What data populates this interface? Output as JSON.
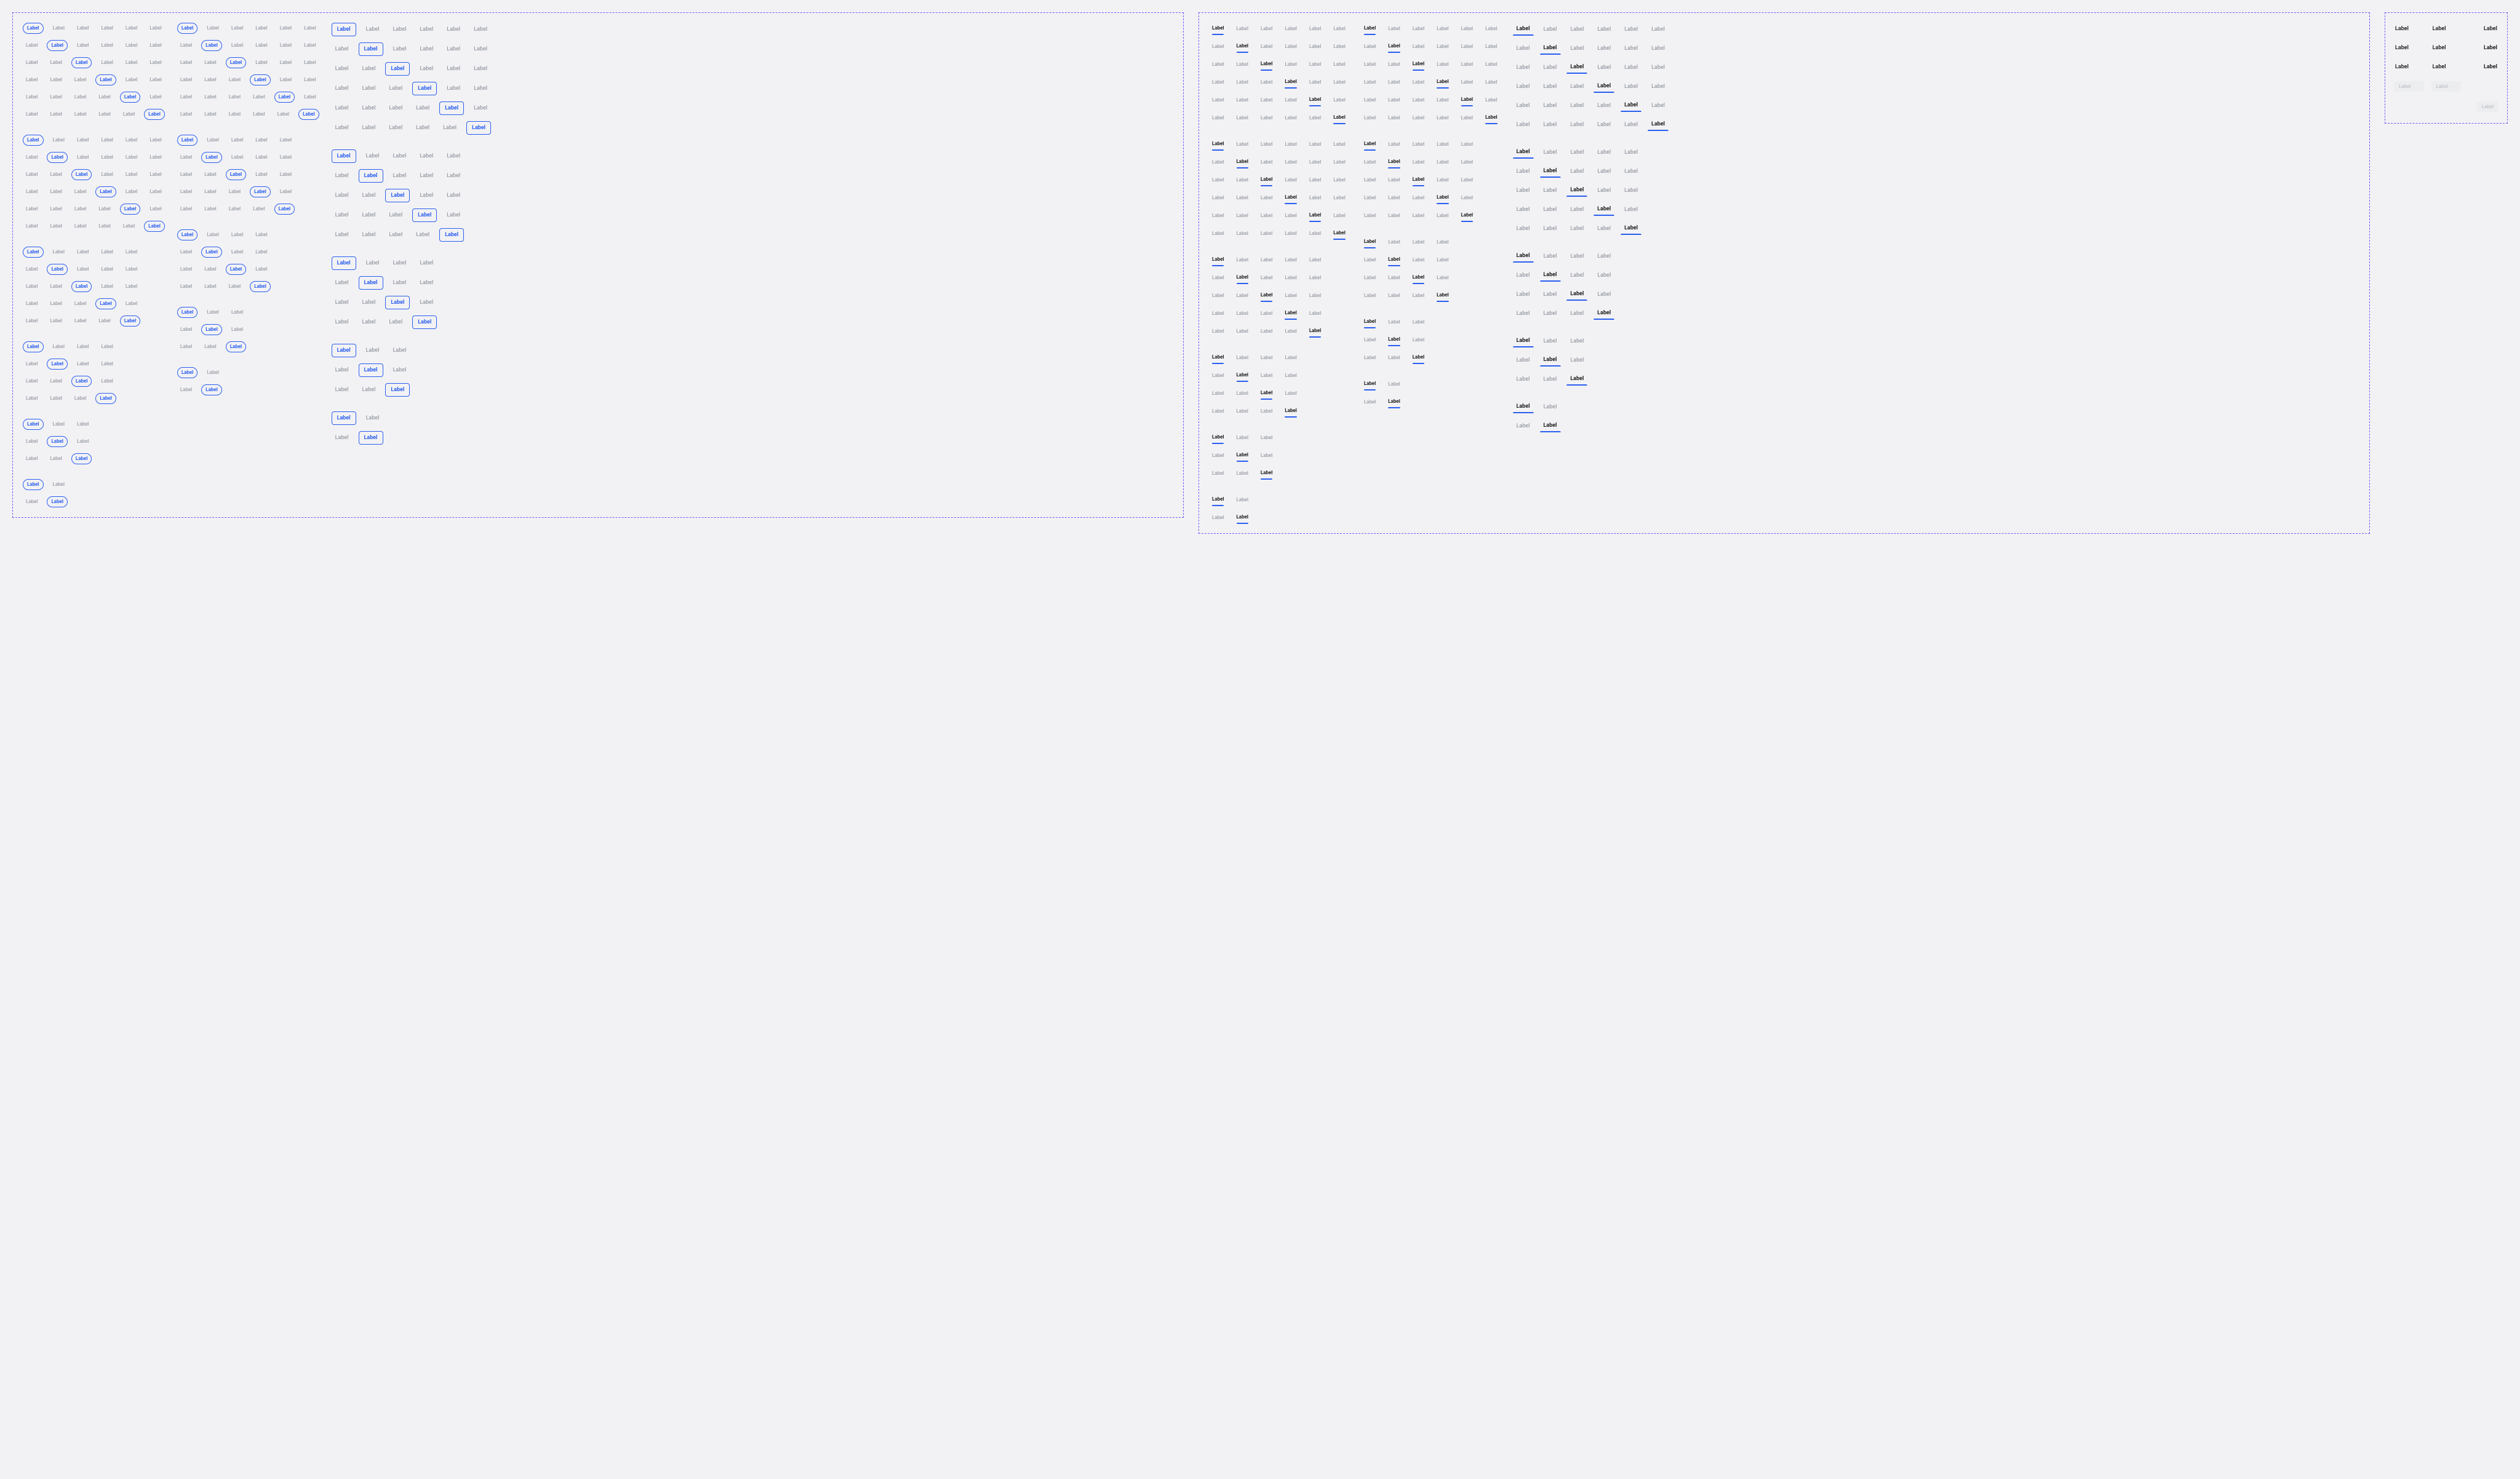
{
  "label": "Label",
  "frames": {
    "left": {
      "columns": [
        {
          "style": "pill",
          "size": "xs",
          "groups": [
            6,
            6,
            5,
            4,
            3,
            2
          ]
        },
        {
          "style": "pill",
          "size": "sm",
          "groups": [
            6,
            5,
            4,
            3,
            2
          ]
        },
        {
          "style": "rect",
          "size": "lg",
          "groups": [
            6,
            5,
            4,
            3,
            2
          ]
        }
      ]
    },
    "right": {
      "columns": [
        {
          "style": "u-short",
          "size": "xs",
          "groups": [
            6,
            6,
            5,
            4,
            3,
            2
          ]
        },
        {
          "style": "u-short",
          "size": "sm",
          "groups": [
            6,
            5,
            4,
            3,
            2
          ]
        },
        {
          "style": "u-blue",
          "size": "lg",
          "groups": [
            6,
            5,
            4,
            3,
            2
          ]
        }
      ]
    }
  },
  "side_buttons": {
    "rows": [
      {
        "cells": [
          "plain",
          "plain",
          "plain-right"
        ]
      },
      {
        "cells": [
          "plain",
          "plain",
          "plain-right-bold"
        ]
      },
      {
        "cells": [
          "plain",
          "plain",
          "plain-right-bold"
        ]
      },
      {
        "cells": [
          "chip-disabled",
          "chip-disabled",
          "empty"
        ]
      },
      {
        "cells": [
          "empty",
          "empty",
          "chip-disabled-right"
        ]
      }
    ]
  }
}
